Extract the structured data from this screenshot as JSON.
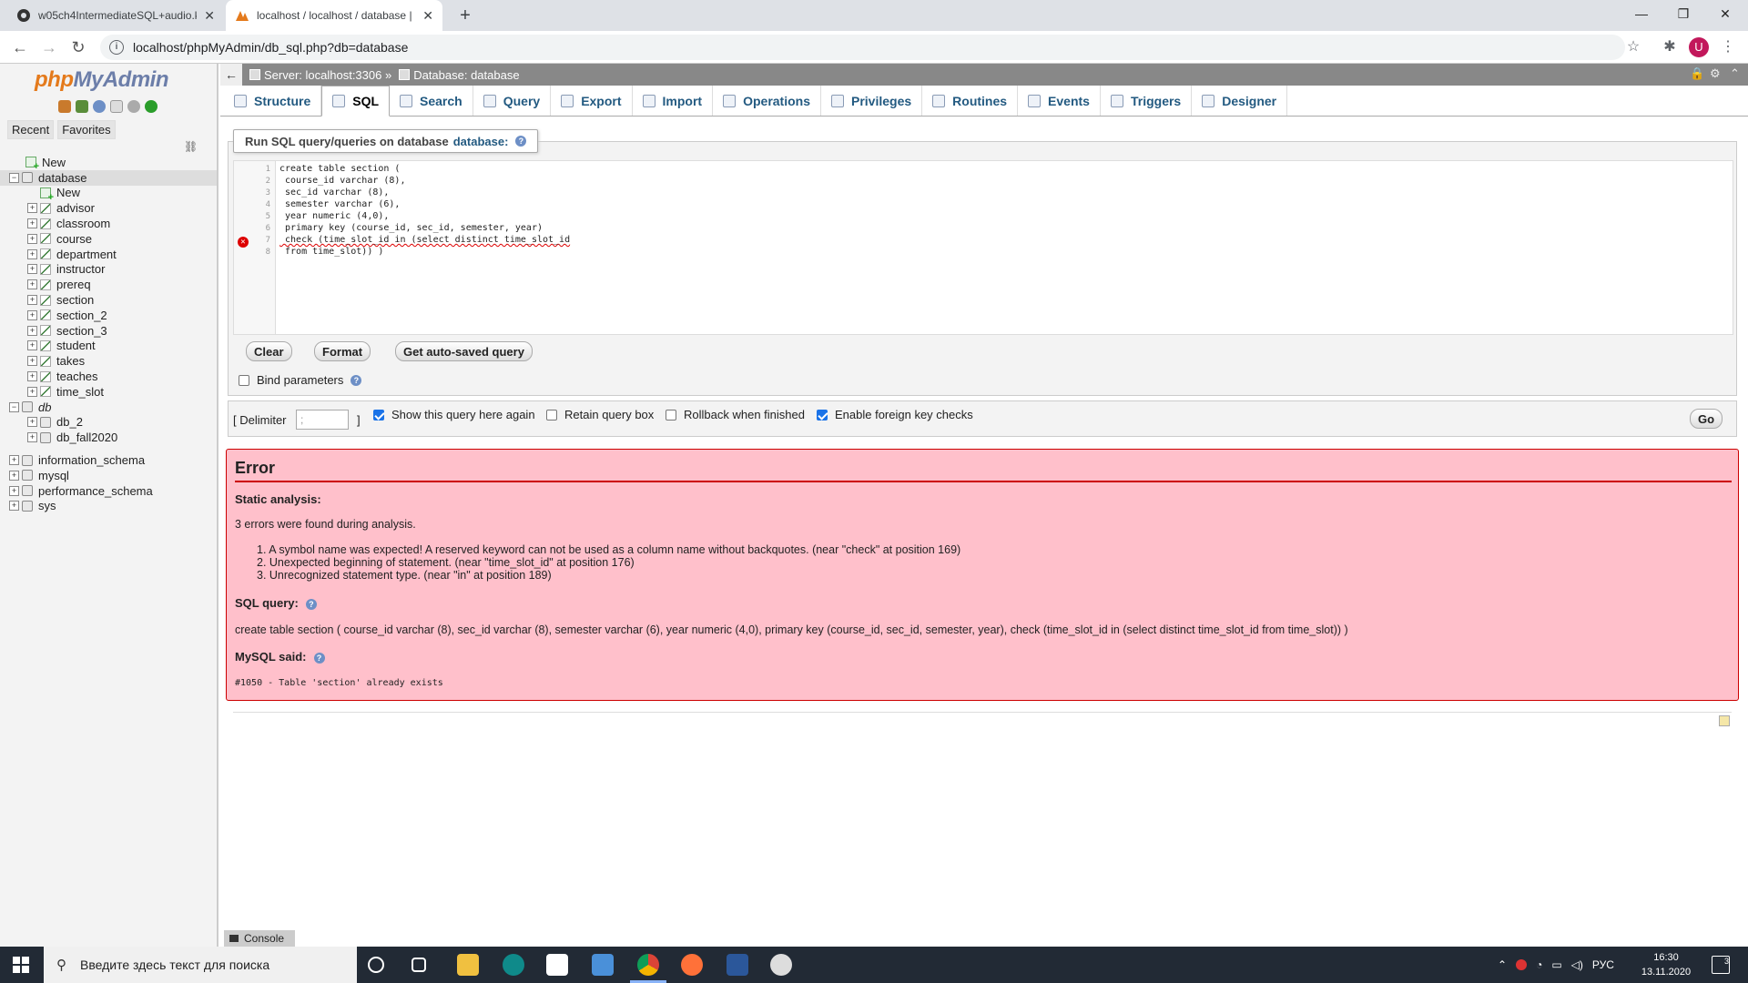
{
  "browser": {
    "tabs": [
      {
        "title": "w05ch4IntermediateSQL+audio.k"
      },
      {
        "title": "localhost / localhost / database |"
      }
    ],
    "url": "localhost/phpMyAdmin/db_sql.php?db=database",
    "avatar_letter": "U"
  },
  "nav": {
    "logo_php": "php",
    "logo_my": "MyAdmin",
    "tabs": [
      "Recent",
      "Favorites"
    ],
    "tree": [
      {
        "label": "New",
        "level": 1,
        "kind": "new"
      },
      {
        "label": "database",
        "level": 0,
        "kind": "db",
        "expanded": true,
        "selected": true
      },
      {
        "label": "New",
        "level": 2,
        "kind": "new"
      },
      {
        "label": "advisor",
        "level": 2,
        "kind": "table"
      },
      {
        "label": "classroom",
        "level": 2,
        "kind": "table"
      },
      {
        "label": "course",
        "level": 2,
        "kind": "table"
      },
      {
        "label": "department",
        "level": 2,
        "kind": "table"
      },
      {
        "label": "instructor",
        "level": 2,
        "kind": "table"
      },
      {
        "label": "prereq",
        "level": 2,
        "kind": "table"
      },
      {
        "label": "section",
        "level": 2,
        "kind": "table"
      },
      {
        "label": "section_2",
        "level": 2,
        "kind": "table"
      },
      {
        "label": "section_3",
        "level": 2,
        "kind": "table"
      },
      {
        "label": "student",
        "level": 2,
        "kind": "table"
      },
      {
        "label": "takes",
        "level": 2,
        "kind": "table"
      },
      {
        "label": "teaches",
        "level": 2,
        "kind": "table"
      },
      {
        "label": "time_slot",
        "level": 2,
        "kind": "table"
      },
      {
        "label": "db",
        "level": 0,
        "kind": "group",
        "expanded": true
      },
      {
        "label": "db_2",
        "level": 2,
        "kind": "db"
      },
      {
        "label": "db_fall2020",
        "level": 2,
        "kind": "db"
      },
      {
        "label": "",
        "level": 0,
        "kind": "spacer"
      },
      {
        "label": "information_schema",
        "level": 0,
        "kind": "db"
      },
      {
        "label": "mysql",
        "level": 0,
        "kind": "db"
      },
      {
        "label": "performance_schema",
        "level": 0,
        "kind": "db"
      },
      {
        "label": "sys",
        "level": 0,
        "kind": "db"
      }
    ]
  },
  "breadcrumb": {
    "server": "Server: localhost:3306 »",
    "database": "Database: database"
  },
  "menu": [
    {
      "label": "Structure",
      "active": false
    },
    {
      "label": "SQL",
      "active": true
    },
    {
      "label": "Search",
      "active": false
    },
    {
      "label": "Query",
      "active": false
    },
    {
      "label": "Export",
      "active": false
    },
    {
      "label": "Import",
      "active": false
    },
    {
      "label": "Operations",
      "active": false
    },
    {
      "label": "Privileges",
      "active": false
    },
    {
      "label": "Routines",
      "active": false
    },
    {
      "label": "Events",
      "active": false
    },
    {
      "label": "Triggers",
      "active": false
    },
    {
      "label": "Designer",
      "active": false
    }
  ],
  "sql_panel": {
    "legend_prefix": "Run SQL query/queries on database",
    "legend_db": "database:",
    "lines": [
      "create table section (",
      " course_id varchar (8),",
      " sec_id varchar (8),",
      " semester varchar (6),",
      " year numeric (4,0),",
      " primary key (course_id, sec_id, semester, year)",
      " check (time_slot_id in (select distinct time_slot_id",
      " from time_slot)) )"
    ],
    "buttons": {
      "clear": "Clear",
      "format": "Format",
      "autosaved": "Get auto-saved query"
    },
    "bind_params": "Bind parameters"
  },
  "options": {
    "delimiter_open": "[ Delimiter",
    "delimiter_value": ";",
    "delimiter_close": "]",
    "show_query": "Show this query here again",
    "retain": "Retain query box",
    "rollback": "Rollback when finished",
    "foreign": "Enable foreign key checks",
    "go": "Go"
  },
  "error": {
    "title": "Error",
    "static_label": "Static analysis:",
    "summary": "3 errors were found during analysis.",
    "items": [
      "1.  A symbol name was expected! A reserved keyword can not be used as a column name without backquotes. (near \"check\" at position 169)",
      "2.  Unexpected beginning of statement. (near \"time_slot_id\" at position 176)",
      "3.  Unrecognized statement type. (near \"in\" at position 189)"
    ],
    "sql_label": "SQL query:",
    "sql_text": "create table section ( course_id varchar (8), sec_id varchar (8), semester varchar (6), year numeric (4,0), primary key (course_id, sec_id, semester, year), check (time_slot_id in (select distinct time_slot_id from time_slot)) )",
    "mysql_label": "MySQL said:",
    "mysql_text": "#1050 - Table 'section' already exists"
  },
  "console_label": "Console",
  "taskbar": {
    "search_placeholder": "Введите здесь текст для поиска",
    "lang": "РУС",
    "time": "16:30",
    "date": "13.11.2020",
    "notif_count": "3"
  }
}
